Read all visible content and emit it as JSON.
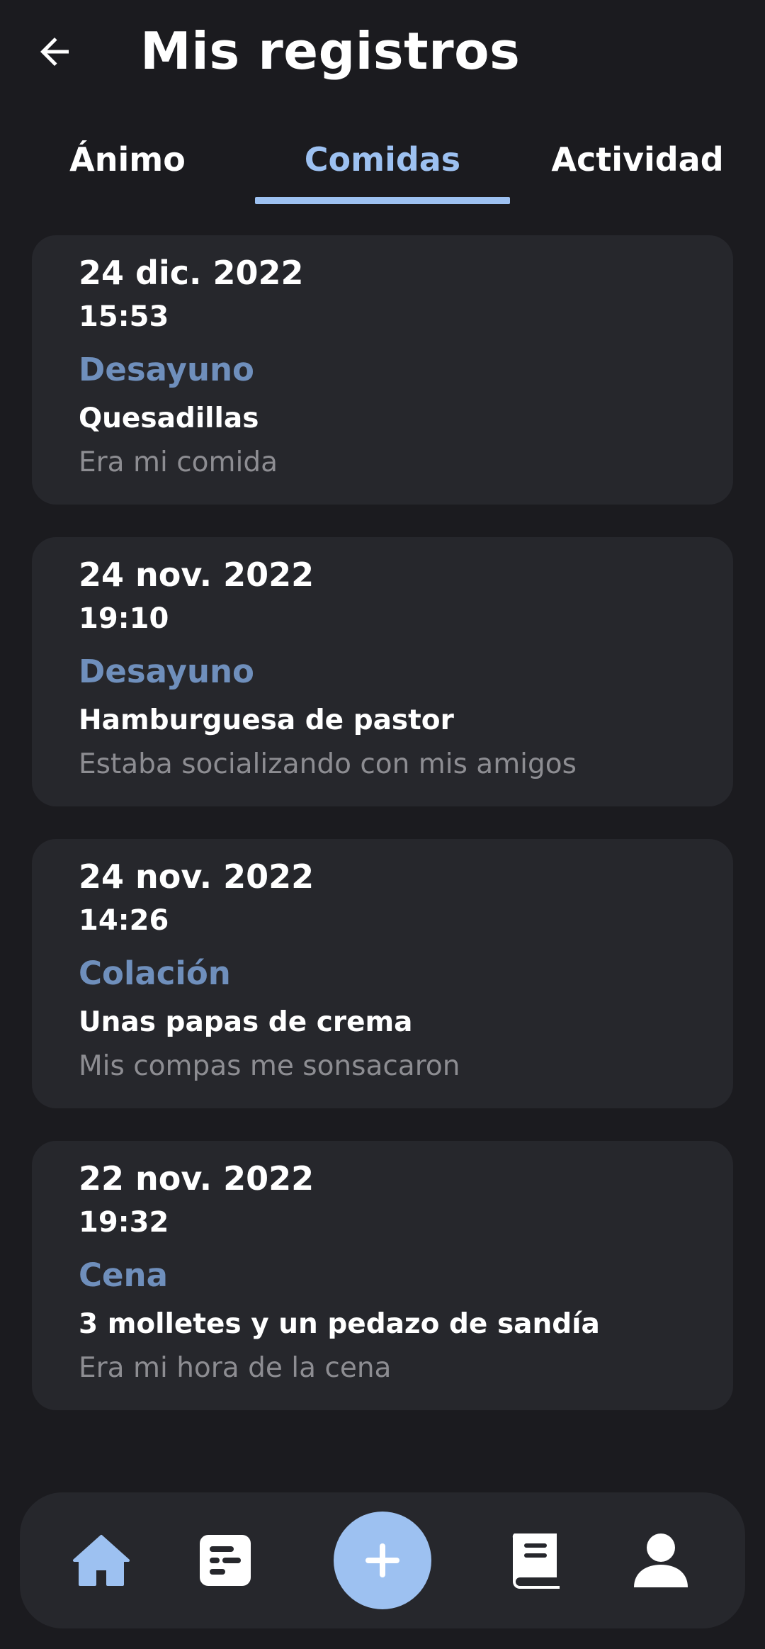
{
  "header": {
    "title": "Mis registros",
    "back_icon": "arrow-left-icon"
  },
  "tabs": [
    {
      "label": "Ánimo",
      "selected": false
    },
    {
      "label": "Comidas",
      "selected": true
    },
    {
      "label": "Actividad",
      "selected": false
    }
  ],
  "colors": {
    "background": "#1b1b1f",
    "card": "#26272c",
    "accent": "#9dc1f1",
    "meal_type": "#6f8fbc",
    "muted_text": "#8d8d92"
  },
  "records": [
    {
      "date": "24 dic. 2022",
      "time": "15:53",
      "type": "Desayuno",
      "food": "Quesadillas",
      "note": "Era mi comida"
    },
    {
      "date": "24 nov. 2022",
      "time": "19:10",
      "type": "Desayuno",
      "food": "Hamburguesa de pastor",
      "note": "Estaba socializando con mis amigos"
    },
    {
      "date": "24 nov. 2022",
      "time": "14:26",
      "type": "Colación",
      "food": "Unas papas de crema",
      "note": "Mis compas me sonsacaron"
    },
    {
      "date": "22 nov. 2022",
      "time": "19:32",
      "type": "Cena",
      "food": "3 molletes y un pedazo de sandía",
      "note": "Era mi hora de la cena"
    }
  ],
  "bottom_nav": {
    "items": [
      {
        "icon": "home-icon",
        "active": true
      },
      {
        "icon": "records-icon",
        "active": false
      },
      {
        "icon": "plus-icon",
        "active": false
      },
      {
        "icon": "book-icon",
        "active": false
      },
      {
        "icon": "user-icon",
        "active": false
      }
    ]
  }
}
